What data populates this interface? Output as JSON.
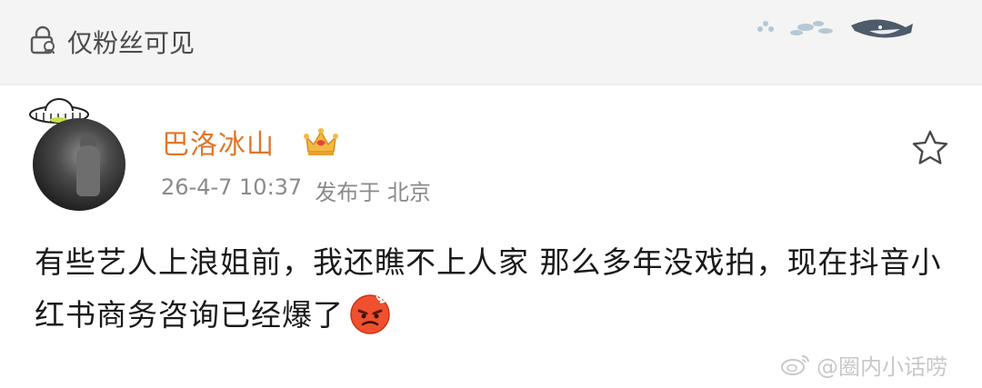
{
  "header": {
    "privacy_label": "仅粉丝可见",
    "privacy_icon": "lock-person-icon"
  },
  "post": {
    "author": "巴洛冰山",
    "badge_icon": "crown-icon",
    "timestamp": "26-4-7 10:37",
    "location": "发布于 北京",
    "text": "有些艺人上浪姐前，我还瞧不上人家 那么多年没戏拍，现在抖音小红书商务咨询已经爆了",
    "emoji_icon": "angry-face-icon",
    "favorite_icon": "star-icon"
  },
  "watermark": {
    "text": "@圈内小话唠"
  },
  "colors": {
    "username": "#e0762a",
    "meta": "#8a8a8a",
    "body_text": "#1a1a1a",
    "header_bg": "#f4f4f4"
  }
}
